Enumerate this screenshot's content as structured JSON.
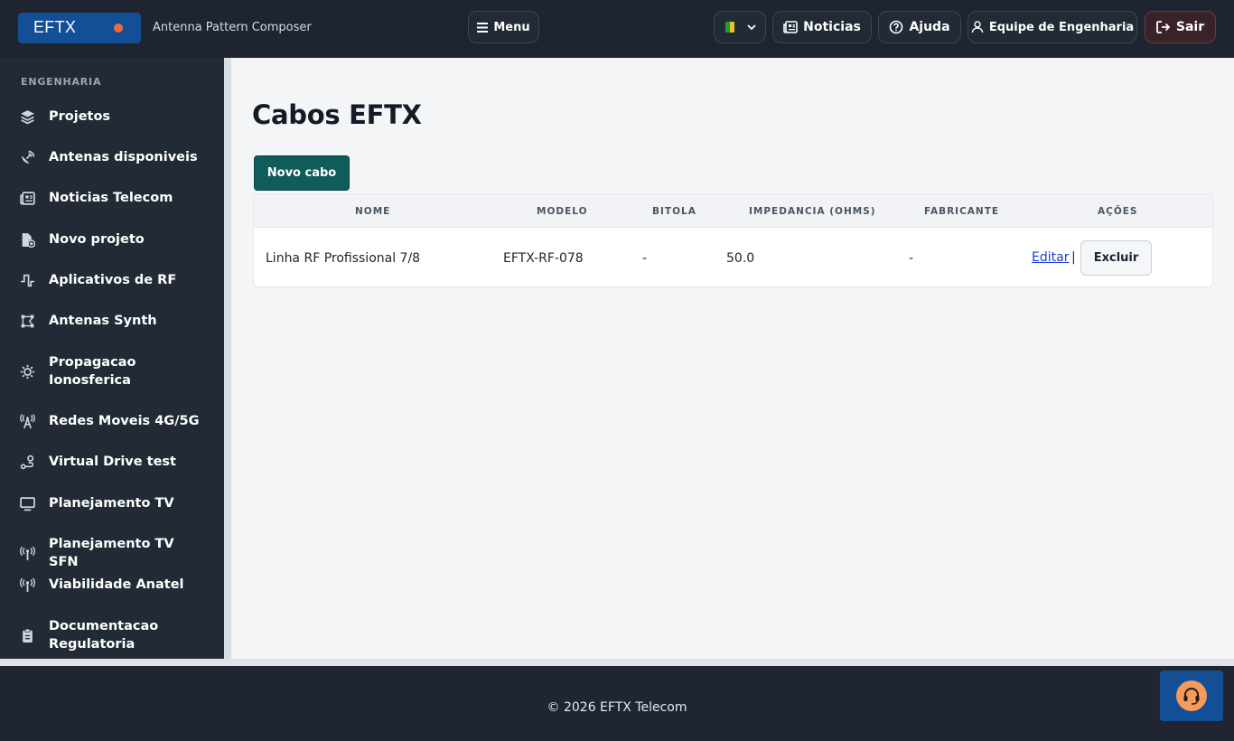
{
  "header": {
    "logo": "EFTX",
    "subtitle": "Antenna Pattern Composer",
    "menu_label": "Menu",
    "news_label": "Noticias",
    "help_label": "Ajuda",
    "team_label": "Equipe de Engenharia",
    "logout_label": "Sair",
    "icons": {
      "menu": "hamburger-icon",
      "language": "brazil-flag-icon",
      "news": "newspaper-icon",
      "help": "question-circle-icon",
      "team": "user-icon",
      "logout": "logout-icon"
    },
    "colors": {
      "logo_bg": "#124f96",
      "logo_dot": "#f26a3a",
      "bar_bg": "#1e2530"
    }
  },
  "sidebar": {
    "section": "ENGENHARIA",
    "items": [
      {
        "label": "Projetos",
        "icon": "layers-icon"
      },
      {
        "label": "Antenas disponiveis",
        "icon": "satellite-dish-icon"
      },
      {
        "label": "Noticias Telecom",
        "icon": "newspaper-icon"
      },
      {
        "label": "Novo projeto",
        "icon": "file-plus-icon"
      },
      {
        "label": "Aplicativos de RF",
        "icon": "signal-wave-icon"
      },
      {
        "label": "Antenas Synth",
        "icon": "vector-shape-icon"
      },
      {
        "label": "Propagacao Ionosferica",
        "icon": "gear-sun-icon"
      },
      {
        "label": "Redes Moveis 4G/5G",
        "icon": "cell-tower-icon"
      },
      {
        "label": "Virtual Drive test",
        "icon": "route-icon"
      },
      {
        "label": "Planejamento TV",
        "icon": "monitor-icon"
      },
      {
        "label": "Planejamento TV SFN",
        "icon": "broadcast-icon"
      },
      {
        "label": "Viabilidade Anatel",
        "icon": "broadcast-icon"
      },
      {
        "label": "Documentacao Regulatoria",
        "icon": "clipboard-icon"
      }
    ]
  },
  "main": {
    "title": "Cabos EFTX",
    "new_button": "Novo cabo",
    "table": {
      "headers": [
        "NOME",
        "MODELO",
        "BITOLA",
        "IMPEDANCIA (OHMS)",
        "FABRICANTE",
        "AÇÕES"
      ],
      "rows": [
        {
          "nome": "Linha RF Profissional 7/8",
          "modelo": "EFTX-RF-078",
          "bitola": "-",
          "impedancia": "50.0",
          "fabricante": "-",
          "edit": "Editar",
          "separator": "|",
          "delete": "Excluir"
        }
      ]
    },
    "colors": {
      "primary_button": "#105c5a",
      "link": "#1a3fd1"
    }
  },
  "footer": {
    "copyright": "© 2026 EFTX Telecom",
    "support_icon": "headset-icon"
  }
}
